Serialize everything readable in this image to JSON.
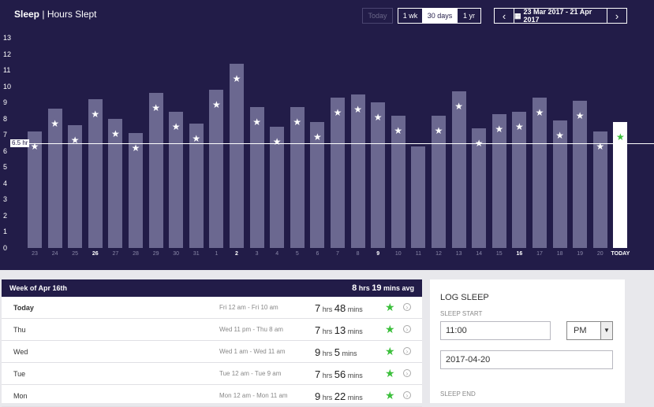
{
  "header": {
    "title_main": "Sleep",
    "title_sep": " | ",
    "title_sub": "Hours Slept"
  },
  "controls": {
    "today": "Today",
    "one_week": "1 wk",
    "thirty_days": "30 days",
    "one_year": "1 yr",
    "prev": "‹",
    "next": "›",
    "date_range": "23 Mar 2017 - 21 Apr 2017"
  },
  "chart_data": {
    "type": "bar",
    "y_ticks": [
      "13",
      "12",
      "11",
      "10",
      "9",
      "8",
      "7",
      "6",
      "5",
      "4",
      "3",
      "2",
      "1",
      "0"
    ],
    "ylim": [
      0,
      13
    ],
    "categories": [
      "23",
      "24",
      "25",
      "26",
      "27",
      "28",
      "29",
      "30",
      "31",
      "1",
      "2",
      "3",
      "4",
      "5",
      "6",
      "7",
      "8",
      "9",
      "10",
      "11",
      "12",
      "13",
      "14",
      "15",
      "16",
      "17",
      "18",
      "19",
      "20",
      "TODAY"
    ],
    "bold_categories": [
      "26",
      "2",
      "9",
      "16",
      "TODAY"
    ],
    "values": [
      7.2,
      8.6,
      7.6,
      9.2,
      8.0,
      7.1,
      9.6,
      8.4,
      7.7,
      9.8,
      11.4,
      8.7,
      7.5,
      8.7,
      7.8,
      9.3,
      9.5,
      9.0,
      8.2,
      6.3,
      8.2,
      9.7,
      7.4,
      8.3,
      8.4,
      9.3,
      7.9,
      9.1,
      7.2,
      7.8
    ],
    "avg_line_value": 6.5,
    "avg_line_label": "6.5 hr",
    "colors": {
      "bar": "#6b6890",
      "today_bar": "#ffffff",
      "today_star": "#3bbf3b",
      "background": "#221c48"
    }
  },
  "week": {
    "title": "Week of Apr 16th",
    "avg_hrs": "8",
    "avg_hrs_unit": " hrs ",
    "avg_mins": "19",
    "avg_mins_unit": " mins avg",
    "rows": [
      {
        "day": "Today",
        "range": "Fri 12 am - Fri 10 am",
        "hrs": "7",
        "mins": "48"
      },
      {
        "day": "Thu",
        "range": "Wed 11 pm - Thu 8 am",
        "hrs": "7",
        "mins": "13"
      },
      {
        "day": "Wed",
        "range": "Wed 1 am - Wed 11 am",
        "hrs": "9",
        "mins": "5"
      },
      {
        "day": "Tue",
        "range": "Tue 12 am - Tue 9 am",
        "hrs": "7",
        "mins": "56"
      },
      {
        "day": "Mon",
        "range": "Mon 12 am - Mon 11 am",
        "hrs": "9",
        "mins": "22"
      }
    ],
    "hrs_unit": "hrs",
    "mins_unit": "mins"
  },
  "log": {
    "title": "LOG SLEEP",
    "start_label": "SLEEP START",
    "start_time": "11:00",
    "start_ampm": "PM",
    "start_date": "2017-04-20",
    "end_label": "SLEEP END"
  }
}
